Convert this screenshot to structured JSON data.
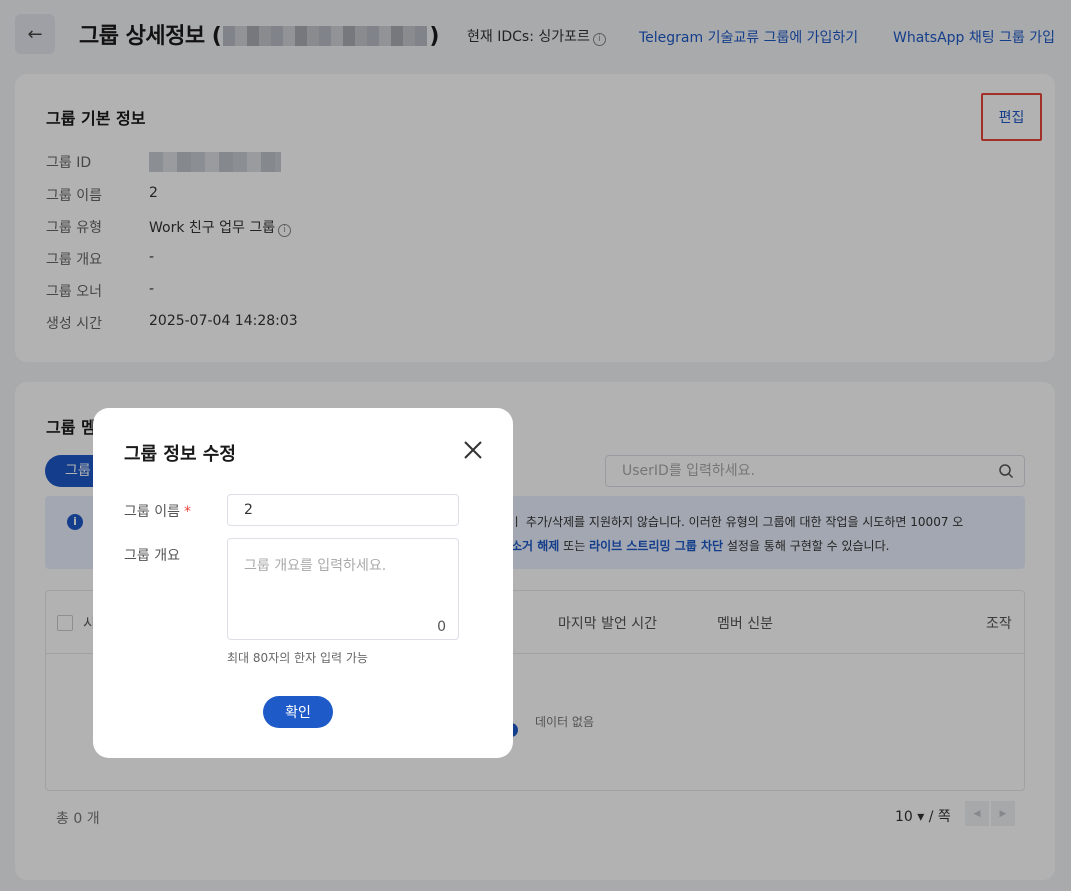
{
  "header": {
    "title_prefix": "그룹 상세정보 (",
    "title_suffix": ")",
    "idc_label": "현재 IDCs: 싱가포르",
    "telegram_link": "Telegram 기술교류 그룹에 가입하기",
    "whatsapp_link": "WhatsApp 채팅 그룹 가입"
  },
  "basic_info": {
    "title": "그룹 기본 정보",
    "edit_label": "편집",
    "rows": [
      {
        "label": "그룹 ID",
        "value": ""
      },
      {
        "label": "그룹 이름",
        "value": "2"
      },
      {
        "label": "그룹 유형",
        "value": "Work 친구 업무 그룹"
      },
      {
        "label": "그룹 개요",
        "value": "-"
      },
      {
        "label": "그룹 오너",
        "value": "-"
      },
      {
        "label": "생성 시간",
        "value": "2025-07-04 14:28:03"
      }
    ]
  },
  "members": {
    "title_partial": "그룹 멤",
    "button_partial": "그룹",
    "search_placeholder": "UserID를 입력하세요.",
    "alert_line1": "ㅣ 추가/삭제를 지원하지 않습니다. 이러한 유형의 그룹에 대한 작업을 시도하면 10007 오",
    "alert_line2_a": "소거 해제",
    "alert_line2_b": " 또는 ",
    "alert_line2_c": "라이브 스트리밍 그룹 차단",
    "alert_line2_d": " 설정을 통해 구현할 수 있습니다.",
    "columns": {
      "col1_partial": "시",
      "last_speak": "마지막 발언 시간",
      "member_role": "멤버 신분",
      "action": "조작"
    },
    "empty_text": "데이터 없음",
    "total": "총  0 개",
    "page_size": "10 ▾  / 쪽"
  },
  "modal": {
    "title": "그룹 정보 수정",
    "name_label": "그룹 이름",
    "name_value": "2",
    "intro_label": "그룹 개요",
    "intro_placeholder": "그룹 개요를 입력하세요.",
    "intro_count": "0",
    "hint": "최대 80자의 한자 입력 가능",
    "confirm_label": "확인"
  }
}
